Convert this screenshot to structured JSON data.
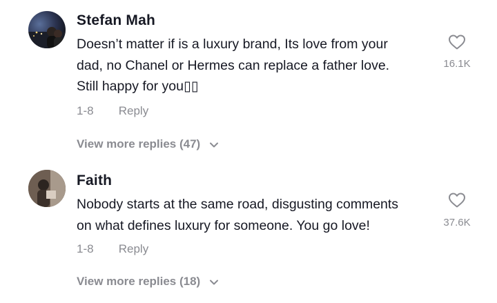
{
  "comments": [
    {
      "username": "Stefan Mah",
      "lines": [
        "Doesn’t matter if is a luxury brand, Its love from your",
        "dad, no Chanel or Hermes can replace a father love.",
        "Still happy for you▯▯"
      ],
      "likes": "16.1K",
      "date": "1-8",
      "reply_label": "Reply",
      "view_more": "View more replies (47)"
    },
    {
      "username": "Faith",
      "lines": [
        "Nobody starts at the same road, disgusting comments",
        "on what defines luxury for someone. You go love!"
      ],
      "likes": "37.6K",
      "date": "1-8",
      "reply_label": "Reply",
      "view_more": "View more replies (18)"
    }
  ],
  "icons": {
    "like": "heart-outline-icon",
    "expand": "chevron-down-icon"
  },
  "colors": {
    "text": "#161823",
    "secondary": "#8a8b91",
    "background": "#ffffff"
  }
}
